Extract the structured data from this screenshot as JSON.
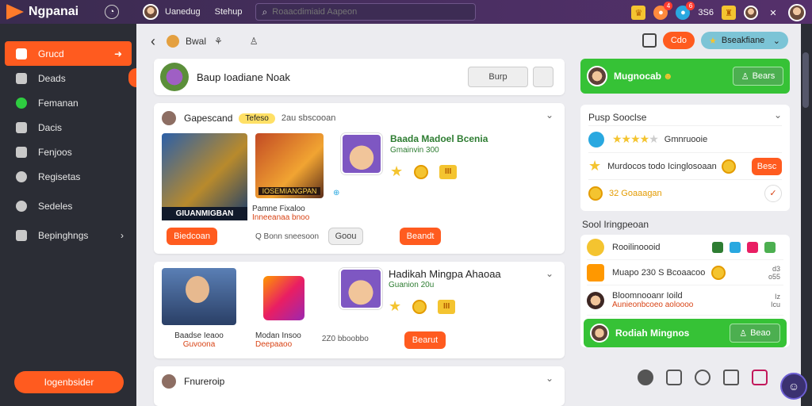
{
  "app": {
    "name": "Ngpanai"
  },
  "topbar": {
    "links": [
      "Uanedug",
      "Stehup"
    ],
    "search_placeholder": "Roaacdimiaid Aapeon",
    "rating_text": "3S6",
    "badge_counts": [
      "4",
      "6"
    ]
  },
  "sidebar": {
    "items": [
      {
        "label": "Grucd",
        "icon": "home-icon",
        "active": true
      },
      {
        "label": "Deads",
        "icon": "dice-icon"
      },
      {
        "label": "Femanan",
        "icon": "circle-d-icon"
      },
      {
        "label": "Dacis",
        "icon": "grid-icon"
      },
      {
        "label": "Fenjoos",
        "icon": "chat-icon"
      },
      {
        "label": "Regisetas",
        "icon": "search-icon"
      },
      {
        "label": "Sedeles",
        "icon": "target-icon"
      },
      {
        "label": "Bepinghngs",
        "icon": "shield-icon",
        "has_chevron": true
      }
    ],
    "cta_label": "Iogenbsider"
  },
  "subbar": {
    "label1": "Bwal",
    "pill_orange": "Cdo",
    "pill_teal": "Bseakfiane"
  },
  "search_card": {
    "query": "Baup  Ioadiane Noak",
    "button_label": "Burp"
  },
  "feed": [
    {
      "author": "Gapescand",
      "tag": "Tefeso",
      "meta": "2au  sbscooan",
      "tile_a_caption": "GIUANMIGBAN",
      "tile_b_caption": "IOSEMIANGPAN",
      "tile_b_sub": "Pamne Fixaloo",
      "tile_b_sub2": "Inneeanaa bnoo",
      "game_title": "Baada Madoel Bcenia",
      "game_sub": "Gmainvin 300",
      "box_label": "III",
      "btn_left": "Biedcoan",
      "mid_meta": "Q  Bonn  sneesoon",
      "btn_gray": "Goou",
      "btn_right": "Beandt"
    },
    {
      "game_title": "Hadikah Mingpa Ahaoaa",
      "game_sub": "Guanion 20u",
      "tile_a_sub": "Baadse Ieaoo",
      "tile_a_sub2": "Guvoona",
      "tile_b_sub": "Modan  Insoo",
      "tile_b_sub2": "Deepaaoo",
      "box_label": "III",
      "mid_meta": "2Z0  bboobbo",
      "btn_right": "Bearut"
    },
    {
      "author": "Fnureroip"
    }
  ],
  "right": {
    "green_top": {
      "name": "Mugnocab",
      "button": "Bears"
    },
    "panel": {
      "title": "Pusp Sooclse",
      "row1": "Gmnruooie",
      "row2": "Murdocos todo Icinglosoaan",
      "row2_btn": "Besc",
      "row3": "32 Goaaagan"
    },
    "section_title": "Sool Iringpeoan",
    "list": [
      {
        "text": "Rooilinoooid"
      },
      {
        "text": "Muapo 230  S Bcoaacoo",
        "r1": "d3",
        "r2": "o55"
      },
      {
        "text": "Bloomnooanr Ioild",
        "sub": "Aunieonbcoeo aoloooo",
        "r1": "Iz",
        "r2": "Icu"
      }
    ],
    "green_bottom": {
      "name": "Rodiah Mingnos",
      "button": "Beao"
    }
  },
  "colors": {
    "accent": "#ff5b1f",
    "green": "#36c236",
    "topbar": "#4b2f63"
  }
}
